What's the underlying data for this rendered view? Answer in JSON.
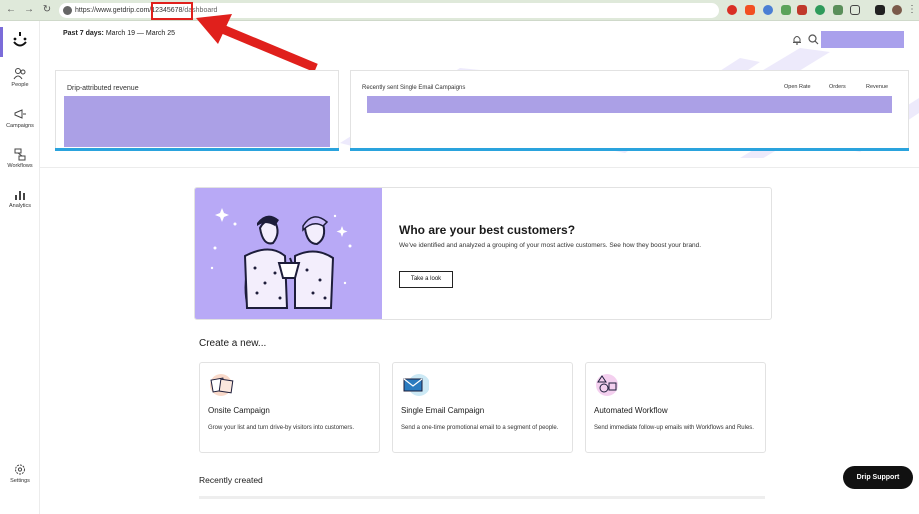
{
  "browser": {
    "url_prefix": "https://www.getdrip.com/",
    "url_id": "12345678",
    "url_suffix": "/dashboard"
  },
  "sidebar": {
    "items": [
      {
        "label": "People",
        "icon": "people-icon"
      },
      {
        "label": "Campaigns",
        "icon": "megaphone-icon"
      },
      {
        "label": "Workflows",
        "icon": "workflow-icon"
      },
      {
        "label": "Analytics",
        "icon": "chart-icon"
      },
      {
        "label": "Settings",
        "icon": "gear-icon"
      }
    ]
  },
  "header": {
    "range_label": "Past 7 days:",
    "range_value": "March 19 — March 25"
  },
  "widgets": {
    "revenue_title": "Drip-attributed revenue",
    "campaigns_title": "Recently sent Single Email Campaigns",
    "columns": [
      "Open Rate",
      "Orders",
      "Revenue"
    ]
  },
  "promo": {
    "title": "Who are your best customers?",
    "text": "We've identified and analyzed a grouping of your most active customers. See how they boost your brand.",
    "button": "Take a look"
  },
  "create": {
    "title": "Create a new...",
    "cards": [
      {
        "title": "Onsite Campaign",
        "desc": "Grow your list and turn drive-by visitors into customers."
      },
      {
        "title": "Single Email Campaign",
        "desc": "Send a one-time promotional email to a segment of people."
      },
      {
        "title": "Automated Workflow",
        "desc": "Send immediate follow-up emails with Workflows and Rules."
      }
    ]
  },
  "recent_title": "Recently created",
  "support_label": "Drip Support",
  "colors": {
    "accent_purple": "#aba0e6",
    "accent_blue": "#2aa3dd",
    "annotation_red": "#e0201c"
  }
}
